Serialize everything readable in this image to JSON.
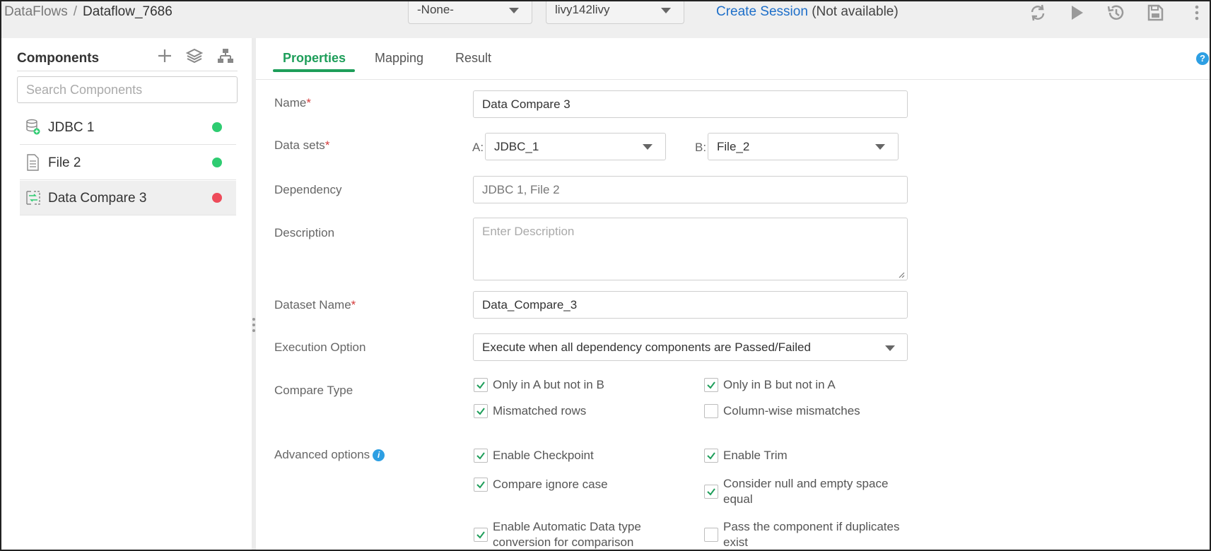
{
  "breadcrumb": {
    "root": "DataFlows",
    "separator": "/",
    "current": "Dataflow_7686"
  },
  "toolbar": {
    "dropdown1": "-None-",
    "dropdown2": "livy142livy",
    "create_session": "Create Session",
    "not_available": "(Not available)",
    "icons": [
      "refresh-icon",
      "play-icon",
      "history-icon",
      "save-icon",
      "more-vertical-icon"
    ]
  },
  "sidebar": {
    "title": "Components",
    "search_placeholder": "Search Components",
    "items": [
      {
        "label": "JDBC 1",
        "icon": "database-icon",
        "status_color": "#2ecc71"
      },
      {
        "label": "File 2",
        "icon": "file-icon",
        "status_color": "#2ecc71"
      },
      {
        "label": "Data Compare 3",
        "icon": "compare-icon",
        "status_color": "#ee4b5a",
        "selected": true
      }
    ]
  },
  "tabs": [
    {
      "label": "Properties",
      "active": true
    },
    {
      "label": "Mapping"
    },
    {
      "label": "Result"
    }
  ],
  "help": "?",
  "form": {
    "name_label": "Name",
    "name_value": "Data Compare 3",
    "datasets_label": "Data sets",
    "dataset_a_prefix": "A:",
    "dataset_a_value": "JDBC_1",
    "dataset_b_prefix": "B:",
    "dataset_b_value": "File_2",
    "dependency_label": "Dependency",
    "dependency_value": "JDBC 1, File 2",
    "description_label": "Description",
    "description_placeholder": "Enter Description",
    "dataset_name_label": "Dataset Name",
    "dataset_name_value": "Data_Compare_3",
    "execution_label": "Execution Option",
    "execution_value": "Execute when all dependency components are Passed/Failed",
    "required_mark": "*",
    "compare_type_label": "Compare Type",
    "compare_type": [
      {
        "label": "Only in A but not in B",
        "checked": true
      },
      {
        "label": "Only in B but not in A",
        "checked": true
      },
      {
        "label": "Mismatched rows",
        "checked": true
      },
      {
        "label": "Column-wise mismatches",
        "checked": false
      }
    ],
    "advanced_label": "Advanced options",
    "advanced_info": "i",
    "advanced": [
      {
        "label": "Enable Checkpoint",
        "checked": true
      },
      {
        "label": "Enable Trim",
        "checked": true
      },
      {
        "label": "Compare ignore case",
        "checked": true
      },
      {
        "label": "Consider null and empty space equal",
        "checked": true
      },
      {
        "label": "Enable Automatic Data type conversion for comparison",
        "checked": true
      },
      {
        "label": "Pass the component if duplicates exist",
        "checked": false
      }
    ]
  },
  "colors": {
    "accent": "#1e9e5a",
    "link": "#1e6fc9",
    "required": "#d43a3a",
    "info": "#2d9fe3"
  }
}
